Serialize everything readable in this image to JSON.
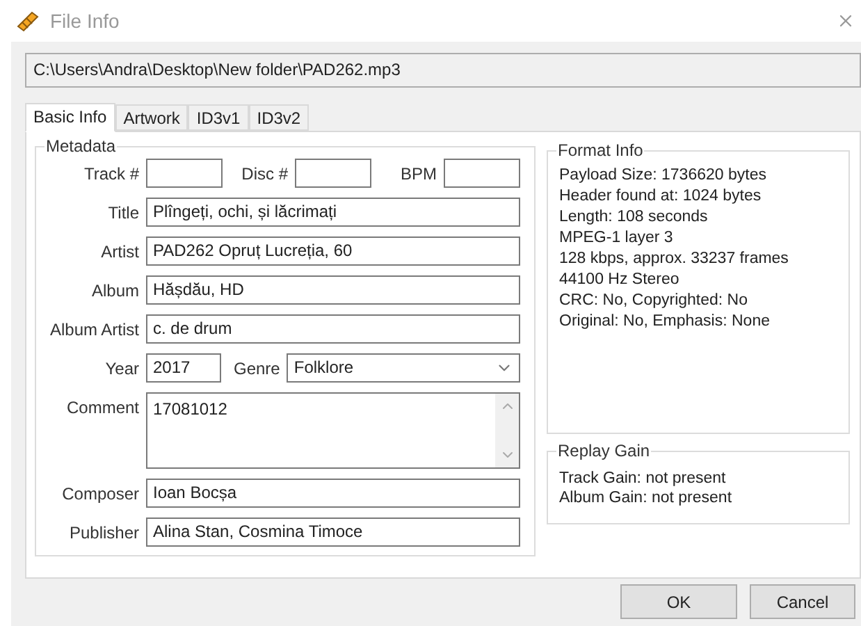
{
  "window": {
    "title": "File Info"
  },
  "path": "C:\\Users\\Andra\\Desktop\\New folder\\PAD262.mp3",
  "tabs": [
    {
      "label": "Basic Info",
      "selected": true
    },
    {
      "label": "Artwork",
      "selected": false
    },
    {
      "label": "ID3v1",
      "selected": false
    },
    {
      "label": "ID3v2",
      "selected": false
    }
  ],
  "metadata": {
    "title": "Metadata",
    "number_fields": [
      {
        "label": "Track #"
      },
      {
        "label": "Disc #"
      },
      {
        "label": "BPM"
      }
    ],
    "fields": [
      {
        "kind": "text",
        "label": "Title",
        "value": "Plîngeți, ochi, și lăcrimați"
      },
      {
        "kind": "text",
        "label": "Artist",
        "value": "PAD262 Opruț Lucreția, 60"
      },
      {
        "kind": "text",
        "label": "Album",
        "value": "Hășdău, HD"
      },
      {
        "kind": "text",
        "label": "Album Artist",
        "value": "c. de drum"
      },
      {
        "kind": "year_genre",
        "label": "Year",
        "value": "2017",
        "genre_label": "Genre",
        "genre_value": "Folklore"
      },
      {
        "kind": "multiline",
        "label": "Comment",
        "value": "17081012"
      },
      {
        "kind": "text",
        "label": "Composer",
        "value": "Ioan Bocșa"
      },
      {
        "kind": "text",
        "label": "Publisher",
        "value": "Alina Stan, Cosmina Timoce"
      }
    ]
  },
  "format_info": {
    "title": "Format Info",
    "lines": [
      "Payload Size: 1736620 bytes",
      "Header found at: 1024 bytes",
      "Length: 108 seconds",
      "MPEG-1 layer 3",
      "128 kbps, approx. 33237 frames",
      "44100 Hz Stereo",
      "CRC: No, Copyrighted: No",
      "Original: No, Emphasis: None"
    ]
  },
  "replay_gain": {
    "title": "Replay Gain",
    "lines": [
      "Track Gain: not present",
      "Album Gain: not present"
    ]
  },
  "buttons": [
    "OK",
    "Cancel"
  ]
}
